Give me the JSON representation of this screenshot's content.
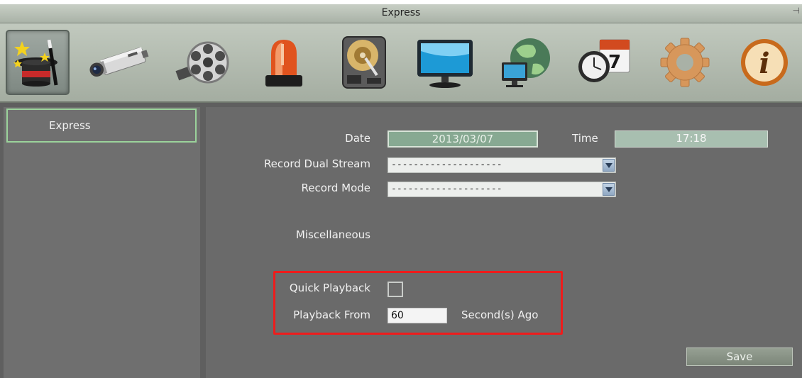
{
  "window": {
    "title": "Express"
  },
  "toolbar": {
    "items": [
      {
        "name": "express-wizard-icon",
        "active": true
      },
      {
        "name": "camera-icon"
      },
      {
        "name": "film-reel-icon"
      },
      {
        "name": "alarm-light-icon"
      },
      {
        "name": "hard-disk-icon"
      },
      {
        "name": "monitor-icon"
      },
      {
        "name": "network-globe-icon"
      },
      {
        "name": "schedule-calendar-icon"
      },
      {
        "name": "gear-icon"
      },
      {
        "name": "info-icon"
      }
    ]
  },
  "sidebar": {
    "items": [
      {
        "label": "Express",
        "selected": true
      }
    ]
  },
  "form": {
    "date_label": "Date",
    "date_value": "2013/03/07",
    "time_label": "Time",
    "time_value": "17:18",
    "dual_stream_label": "Record Dual Stream",
    "dual_stream_value": "--------------------",
    "record_mode_label": "Record Mode",
    "record_mode_value": "--------------------",
    "misc_label": "Miscellaneous",
    "quick_playback_label": "Quick Playback",
    "quick_playback_checked": false,
    "playback_from_label": "Playback From",
    "playback_from_value": "60",
    "playback_unit": "Second(s) Ago",
    "save_label": "Save"
  },
  "colors": {
    "highlight": "#ee1c1c",
    "selection_border": "#9bd39b"
  }
}
